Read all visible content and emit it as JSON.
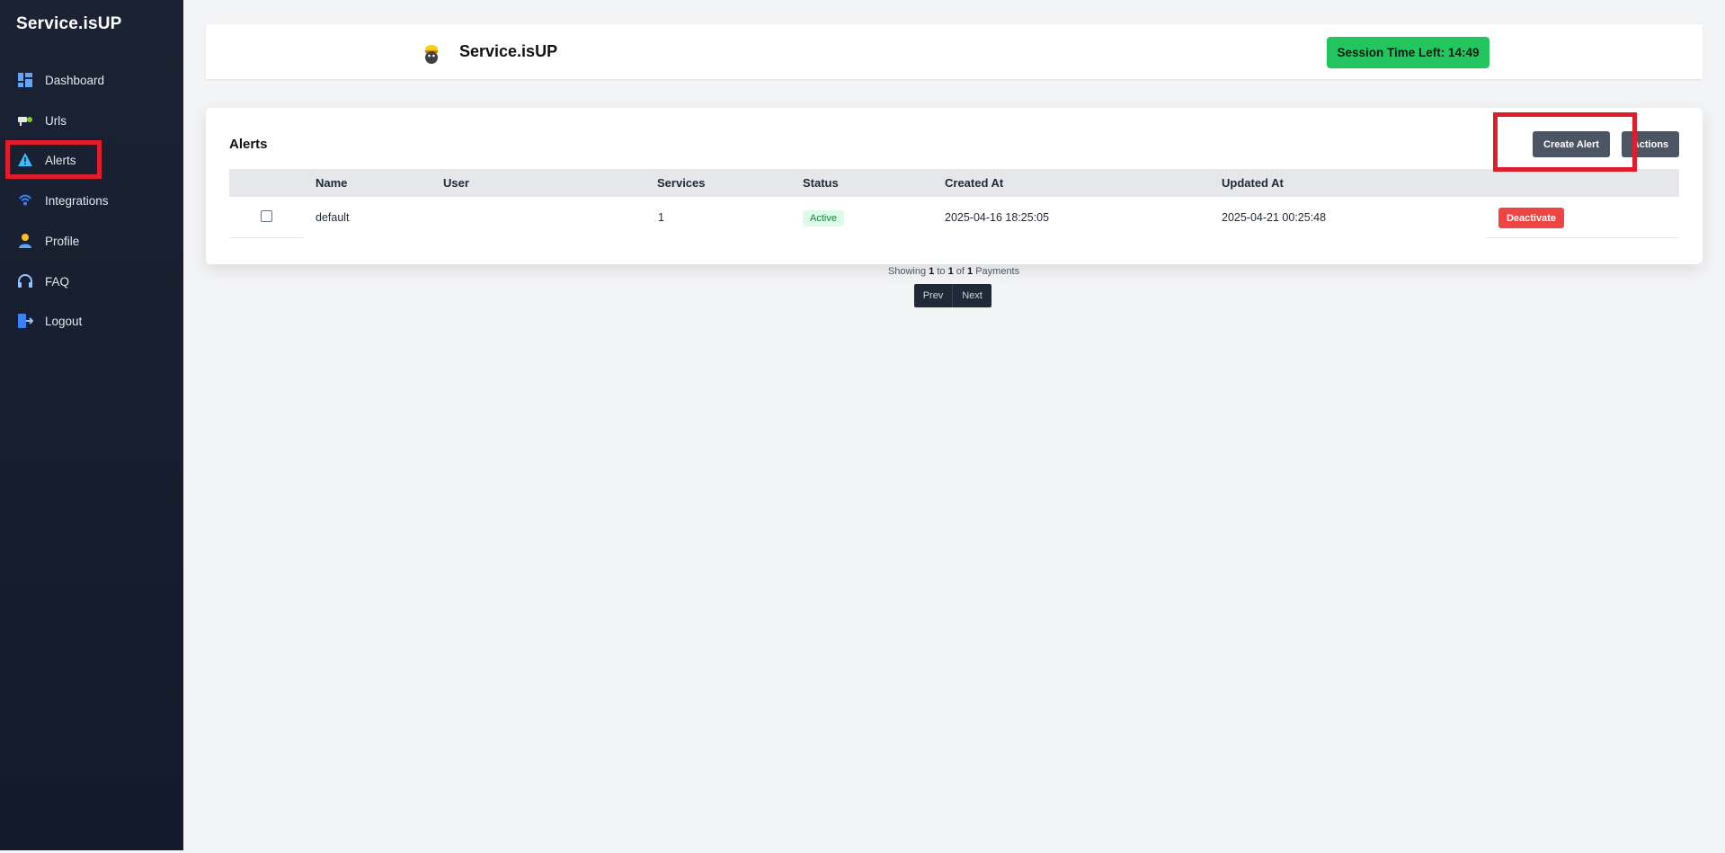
{
  "sidebar": {
    "brand": "Service.isUP",
    "items": [
      {
        "label": "Dashboard",
        "icon": "dashboard-icon"
      },
      {
        "label": "Urls",
        "icon": "url-icon"
      },
      {
        "label": "Alerts",
        "icon": "warning-icon"
      },
      {
        "label": "Integrations",
        "icon": "integration-icon"
      },
      {
        "label": "Profile",
        "icon": "user-icon"
      },
      {
        "label": "FAQ",
        "icon": "headset-icon"
      },
      {
        "label": "Logout",
        "icon": "logout-icon"
      }
    ],
    "active": "Alerts"
  },
  "header": {
    "title": "Service.isUP",
    "session": "Session Time Left: 14:49"
  },
  "alerts": {
    "title": "Alerts",
    "create_label": "Create Alert",
    "actions_label": "Actions",
    "columns": [
      "Name",
      "User",
      "Services",
      "Status",
      "Created At",
      "Updated At"
    ],
    "rows": [
      {
        "name": "default",
        "user": "",
        "services": "1",
        "status": "Active",
        "created": "2025-04-16 18:25:05",
        "updated": "2025-04-21 00:25:48",
        "action": "Deactivate"
      }
    ]
  },
  "pagination": {
    "showing": "Showing",
    "from": "1",
    "to_word": "to",
    "to": "1",
    "of_word": "of",
    "total": "1",
    "unit": "Payments",
    "prev": "Prev",
    "next": "Next"
  },
  "colors": {
    "sidebar_bg": "#1a2233",
    "session_green": "#22c55e",
    "dark_button": "#4b5563",
    "danger": "#ef4444",
    "highlight": "#e11d2b"
  }
}
